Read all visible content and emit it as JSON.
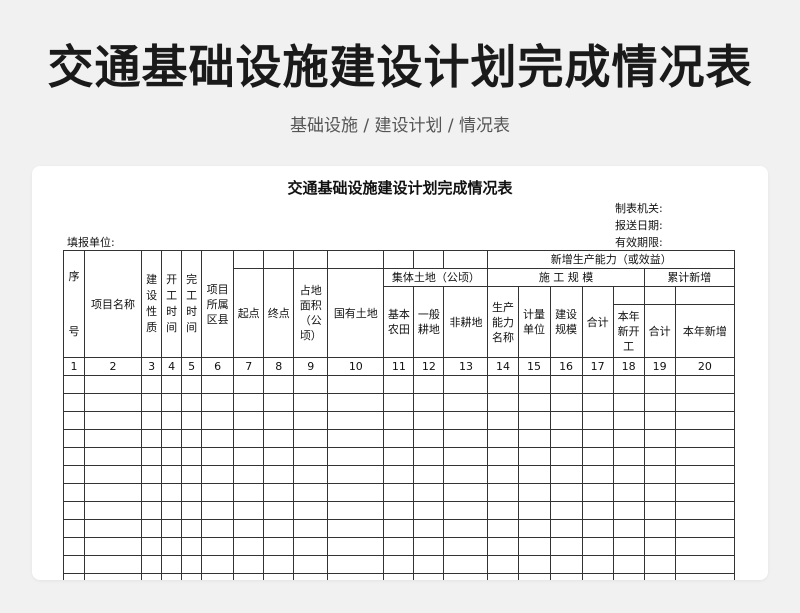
{
  "page": {
    "title": "交通基础设施建设计划完成情况表",
    "breadcrumb": "基础设施 / 建设计划 / 情况表"
  },
  "sheet": {
    "title": "交通基础设施建设计划完成情况表",
    "issuer_label": "制表机关:",
    "date_label": "报送日期:",
    "valid_label": "有效期限:",
    "unit_label": "填报单位:"
  },
  "headers": {
    "seq_top": "序",
    "seq_bottom": "号",
    "project_name": "项目名称",
    "nature": "建设性质",
    "start_time": "开工时间",
    "end_time": "完工时间",
    "county": "项目所属区县",
    "start_point": "起点",
    "end_point": "终点",
    "land_area": "占地面积（公顷）",
    "state_land": "国有土地",
    "collective_land": "集体土地（公顷）",
    "basic_farmland": "基本农田",
    "general_farmland": "一般耕地",
    "non_farmland": "非耕地",
    "new_capacity": "新增生产能力（或效益）",
    "construction_scale": "施 工 规 模",
    "capacity_name": "生产能力名称",
    "unit": "计量单位",
    "build_scale": "建设规模",
    "total1": "合计",
    "year_new_start": "本年新开工",
    "cumulative": "累计新增",
    "total2": "合计",
    "year_new": "本年新增"
  },
  "column_numbers": [
    "1",
    "2",
    "3",
    "4",
    "5",
    "6",
    "7",
    "8",
    "9",
    "10",
    "11",
    "12",
    "13",
    "14",
    "15",
    "16",
    "17",
    "18",
    "19",
    "20"
  ]
}
